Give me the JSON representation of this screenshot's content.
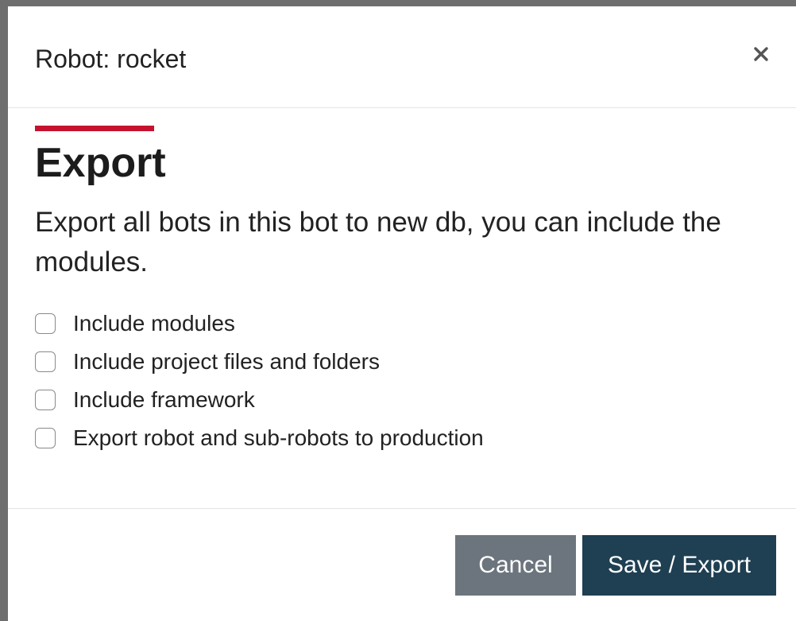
{
  "modal": {
    "title": "Robot: rocket"
  },
  "body": {
    "heading": "Export",
    "description": "Export all bots in this bot to new db, you can include the modules.",
    "options": [
      {
        "label": "Include modules",
        "checked": false
      },
      {
        "label": "Include project files and folders",
        "checked": false
      },
      {
        "label": "Include framework",
        "checked": false
      },
      {
        "label": "Export robot and sub-robots to production",
        "checked": false
      }
    ]
  },
  "footer": {
    "cancel_label": "Cancel",
    "save_label": "Save / Export"
  },
  "colors": {
    "accent": "#c4122f",
    "cancel_bg": "#6c757d",
    "primary_bg": "#1f3f52"
  },
  "icons": {
    "close": "close-icon"
  }
}
